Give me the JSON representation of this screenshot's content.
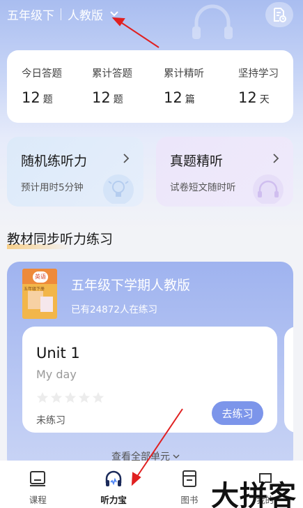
{
  "header": {
    "grade": "五年级下",
    "edition": "人教版",
    "doc_icon": "document-clock-icon"
  },
  "stats": [
    {
      "label": "今日答题",
      "value": "12",
      "unit": "题"
    },
    {
      "label": "累计答题",
      "value": "12",
      "unit": "题"
    },
    {
      "label": "累计精听",
      "value": "12",
      "unit": "篇"
    },
    {
      "label": "坚持学习",
      "value": "12",
      "unit": "天"
    }
  ],
  "quick": {
    "left": {
      "title": "随机练听力",
      "subtitle": "预计用时5分钟"
    },
    "right": {
      "title": "真题精听",
      "subtitle": "试卷短文随时听"
    }
  },
  "section": {
    "title": "教材同步听力练习"
  },
  "course": {
    "book_badge": "英语",
    "book_text": "五年级下册",
    "title": "五年级下学期人教版",
    "subtitle": "已有24872人在练习",
    "unit": {
      "name": "Unit 1",
      "topic": "My day",
      "stars": 0,
      "status": "未练习",
      "button": "去练习"
    },
    "view_all": "查看全部单元"
  },
  "nav": [
    {
      "label": "课程",
      "icon": "course-icon"
    },
    {
      "label": "听力宝",
      "icon": "headphones-icon"
    },
    {
      "label": "图书",
      "icon": "book-icon"
    },
    {
      "label": "我的",
      "icon": "profile-icon"
    }
  ],
  "watermark": "大拼客",
  "colors": {
    "accent": "#7c95ea",
    "arrow": "#e02020",
    "highlight": "#f7cf8a"
  }
}
